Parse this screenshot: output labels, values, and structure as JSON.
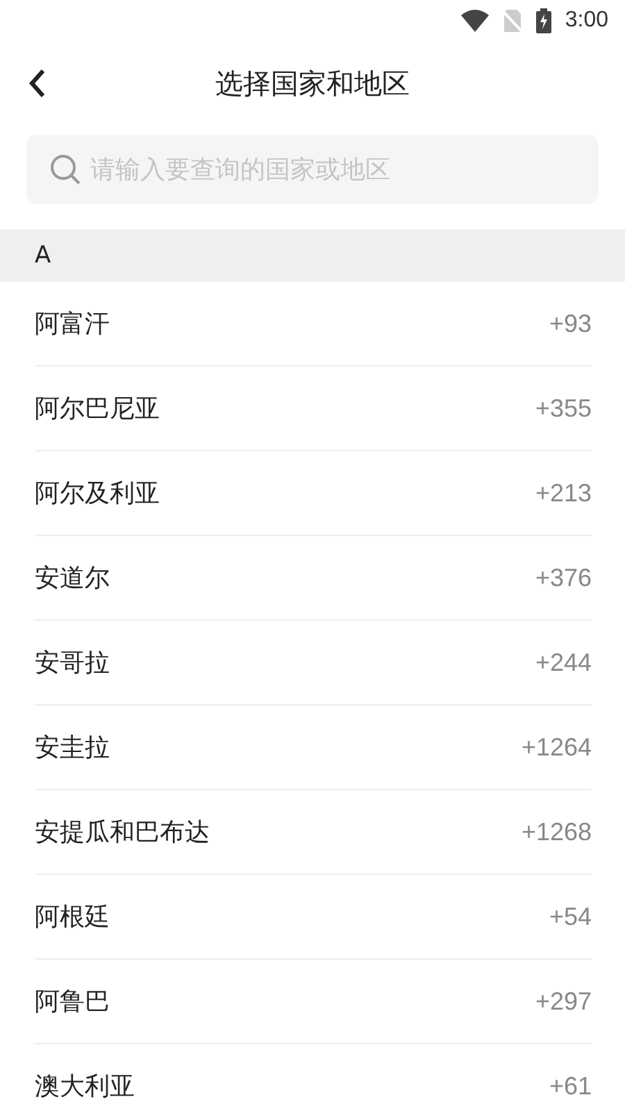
{
  "status_bar": {
    "time": "3:00"
  },
  "header": {
    "title": "选择国家和地区"
  },
  "search": {
    "placeholder": "请输入要查询的国家或地区"
  },
  "sections": [
    {
      "letter": "A",
      "items": [
        {
          "name": "阿富汗",
          "code": "+93"
        },
        {
          "name": "阿尔巴尼亚",
          "code": "+355"
        },
        {
          "name": "阿尔及利亚",
          "code": "+213"
        },
        {
          "name": "安道尔",
          "code": "+376"
        },
        {
          "name": "安哥拉",
          "code": "+244"
        },
        {
          "name": "安圭拉",
          "code": "+1264"
        },
        {
          "name": "安提瓜和巴布达",
          "code": "+1268"
        },
        {
          "name": "阿根廷",
          "code": "+54"
        },
        {
          "name": "阿鲁巴",
          "code": "+297"
        },
        {
          "name": "澳大利亚",
          "code": "+61"
        }
      ]
    }
  ]
}
